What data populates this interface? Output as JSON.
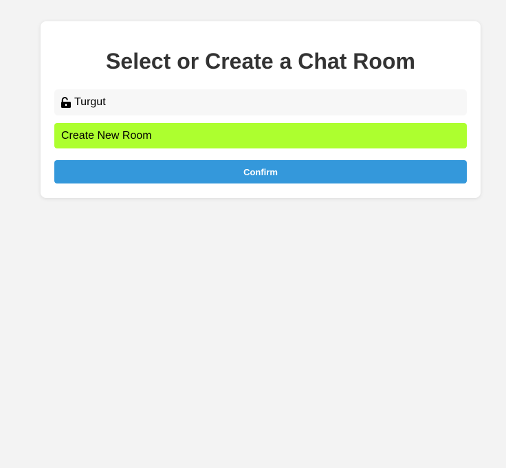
{
  "page": {
    "title": "Select or Create a Chat Room"
  },
  "rooms": [
    {
      "name": "Turgut",
      "icon": "unlocked-padlock-icon"
    }
  ],
  "create_room": {
    "label": "Create New Room",
    "color": "#adff2f"
  },
  "actions": {
    "confirm_label": "Confirm",
    "confirm_color": "#3498db"
  }
}
